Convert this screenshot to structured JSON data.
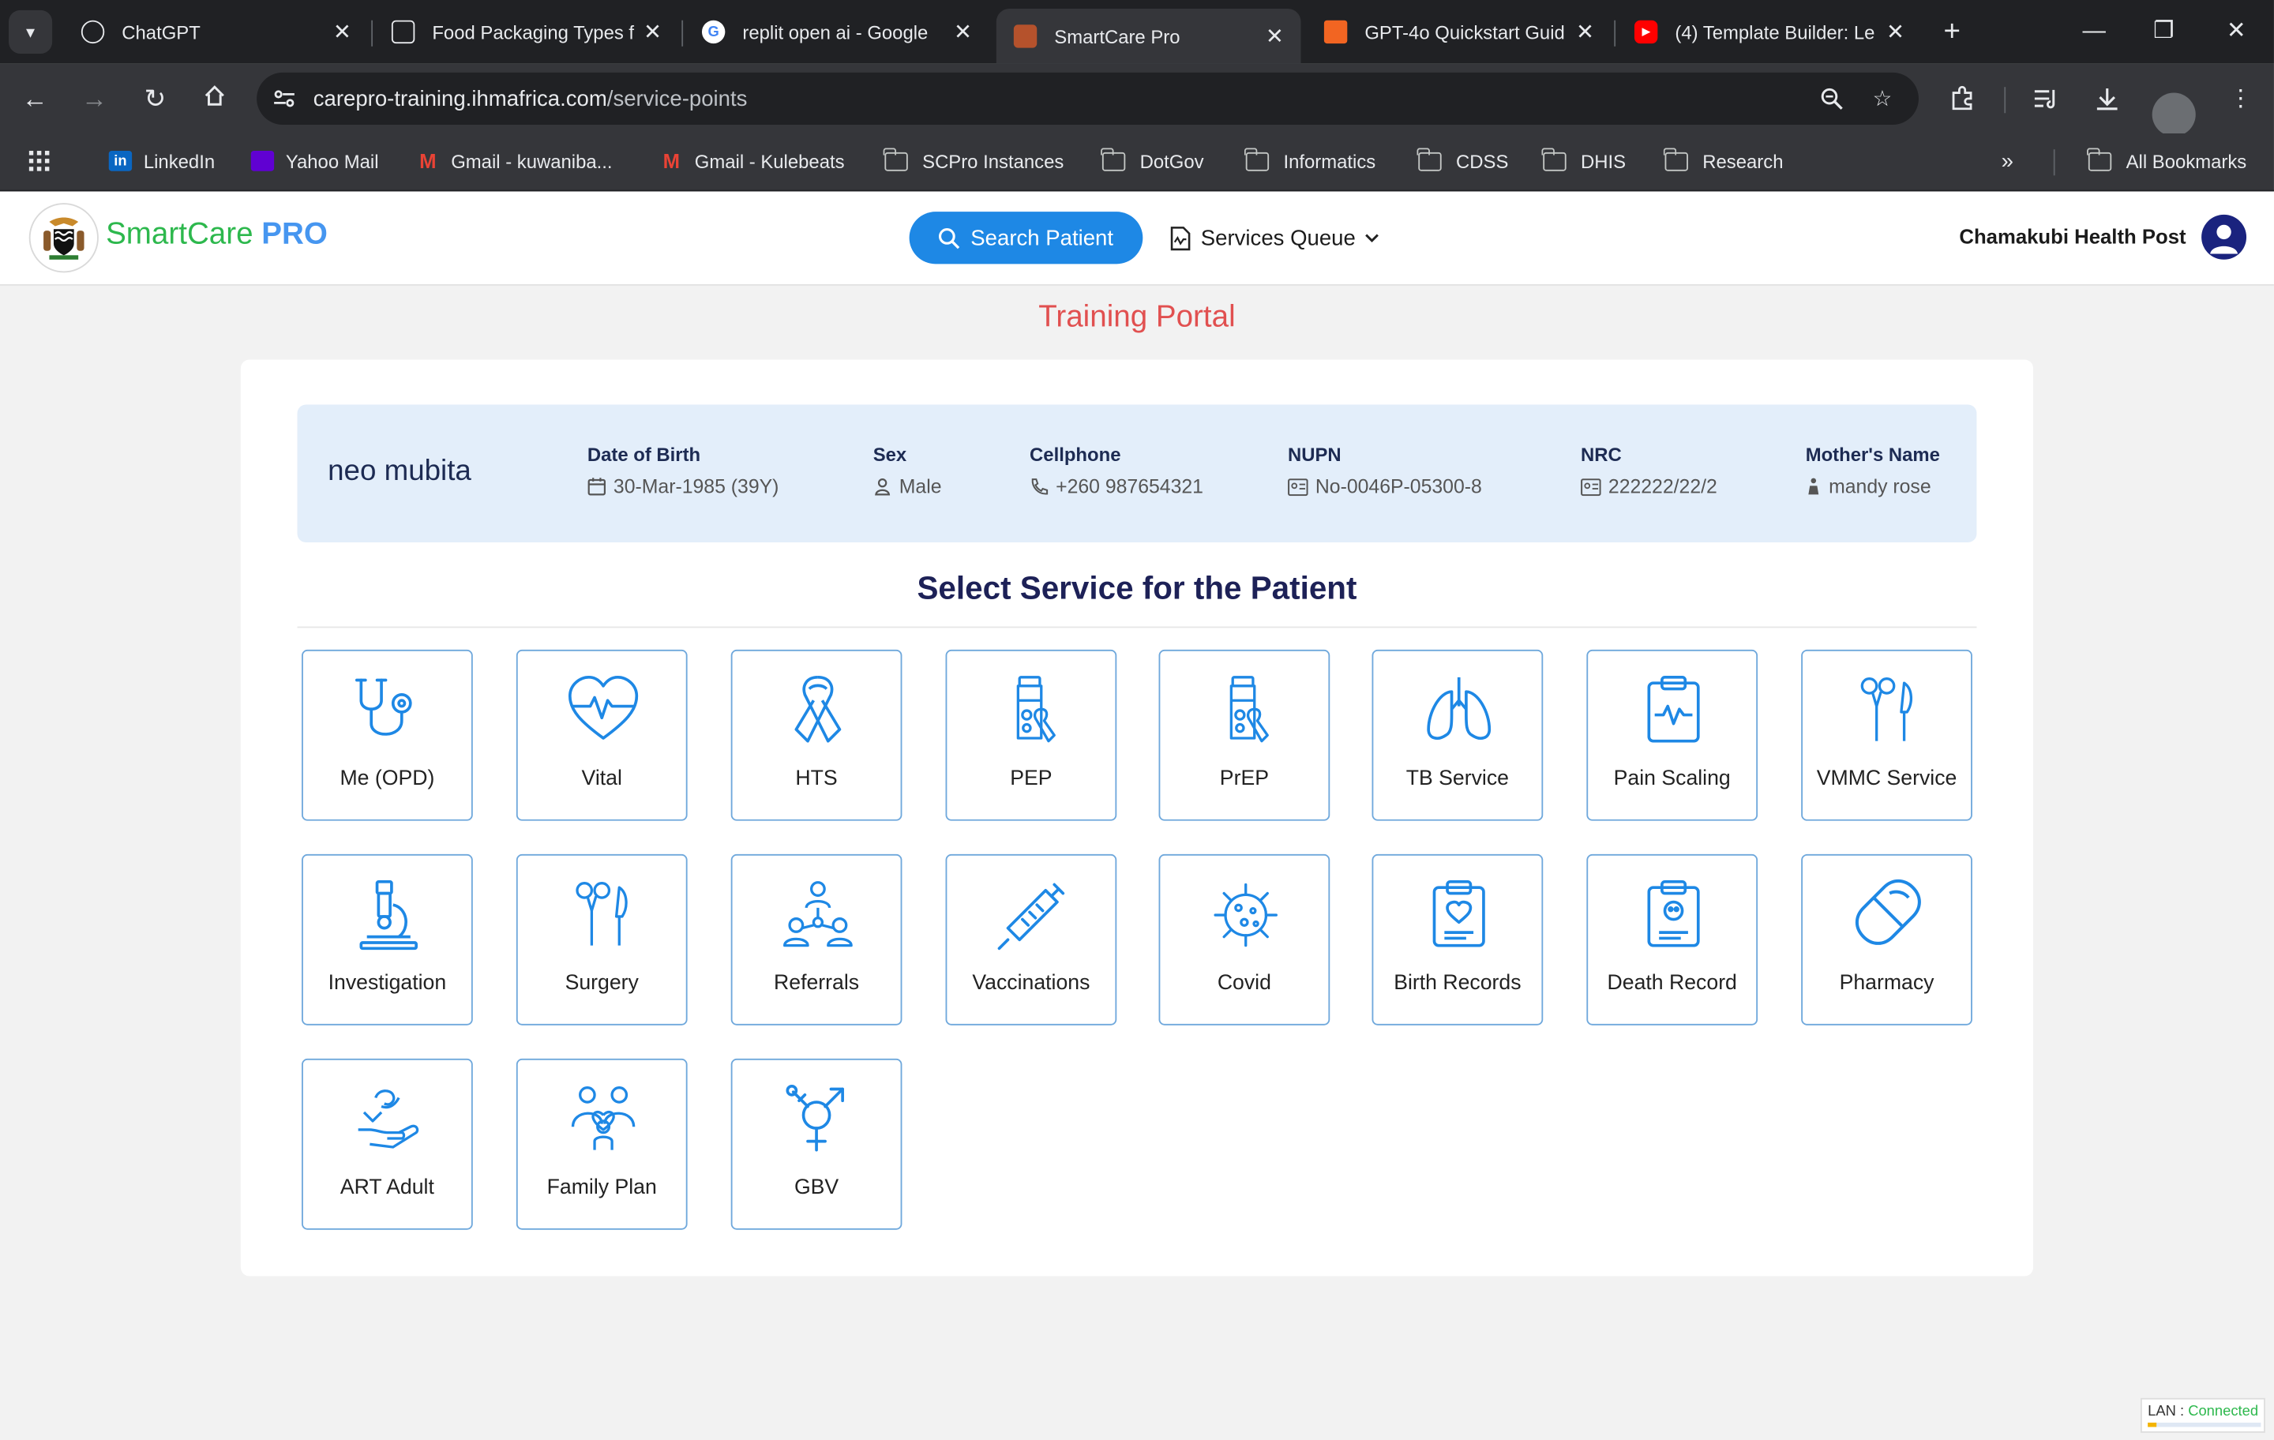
{
  "browser": {
    "tabs": [
      {
        "title": "ChatGPT",
        "favicon": "chatgpt-icon",
        "active": false
      },
      {
        "title": "Food Packaging Types f",
        "favicon": "perplexity-icon",
        "active": false
      },
      {
        "title": "replit open ai - Google",
        "favicon": "google-icon",
        "active": false
      },
      {
        "title": "SmartCare Pro",
        "favicon": "smartcare-icon",
        "active": true
      },
      {
        "title": "GPT-4o Quickstart Guid",
        "favicon": "chunk-icon",
        "active": false
      },
      {
        "title": "(4) Template Builder: Le",
        "favicon": "youtube-icon",
        "active": false
      }
    ],
    "url_host": "carepro-training.ihmafrica.com",
    "url_path": "/service-points",
    "bookmarks": [
      {
        "label": "LinkedIn",
        "icon": "linkedin-icon"
      },
      {
        "label": "Yahoo Mail",
        "icon": "yahoo-icon"
      },
      {
        "label": "Gmail - kuwaniba...",
        "icon": "gmail-icon"
      },
      {
        "label": "Gmail - Kulebeats",
        "icon": "gmail-icon"
      },
      {
        "label": "SCPro Instances",
        "icon": "folder-icon"
      },
      {
        "label": "DotGov",
        "icon": "folder-icon"
      },
      {
        "label": "Informatics",
        "icon": "folder-icon"
      },
      {
        "label": "CDSS",
        "icon": "folder-icon"
      },
      {
        "label": "DHIS",
        "icon": "folder-icon"
      },
      {
        "label": "Research",
        "icon": "folder-icon"
      }
    ],
    "all_bookmarks": "All Bookmarks"
  },
  "app": {
    "brand_part1": "SmartCare ",
    "brand_part2": "PRO",
    "search_button": "Search Patient",
    "queue_button": "Services Queue",
    "facility": "Chamakubi Health Post",
    "portal_title": "Training Portal",
    "section_title": "Select Service for the Patient"
  },
  "patient": {
    "name": "neo mubita",
    "dob_label": "Date of Birth",
    "dob": "30-Mar-1985 (39Y)",
    "sex_label": "Sex",
    "sex": "Male",
    "phone_label": "Cellphone",
    "phone": "+260 987654321",
    "nupn_label": "NUPN",
    "nupn": "No-0046P-05300-8",
    "nrc_label": "NRC",
    "nrc": "222222/22/2",
    "mother_label": "Mother's Name",
    "mother": "mandy rose"
  },
  "services": [
    {
      "label": "Me (OPD)",
      "icon": "stethoscope-icon"
    },
    {
      "label": "Vital",
      "icon": "heart-pulse-icon"
    },
    {
      "label": "HTS",
      "icon": "ribbon-icon"
    },
    {
      "label": "PEP",
      "icon": "medicine-bottle-icon"
    },
    {
      "label": "PrEP",
      "icon": "medicine-bottle-icon"
    },
    {
      "label": "TB Service",
      "icon": "lungs-icon"
    },
    {
      "label": "Pain Scaling",
      "icon": "clipboard-pulse-icon"
    },
    {
      "label": "VMMC Service",
      "icon": "surgical-tools-icon"
    },
    {
      "label": "Investigation",
      "icon": "microscope-icon"
    },
    {
      "label": "Surgery",
      "icon": "surgical-tools-icon"
    },
    {
      "label": "Referrals",
      "icon": "people-network-icon"
    },
    {
      "label": "Vaccinations",
      "icon": "syringe-icon"
    },
    {
      "label": "Covid",
      "icon": "virus-icon"
    },
    {
      "label": "Birth Records",
      "icon": "clipboard-heart-icon"
    },
    {
      "label": "Death Record",
      "icon": "clipboard-skull-icon"
    },
    {
      "label": "Pharmacy",
      "icon": "pill-icon"
    },
    {
      "label": "ART Adult",
      "icon": "hand-pill-icon"
    },
    {
      "label": "Family Plan",
      "icon": "family-icon"
    },
    {
      "label": "GBV",
      "icon": "gender-symbol-icon"
    }
  ],
  "status": {
    "label": "LAN : ",
    "value": "Connected"
  },
  "colors": {
    "accent": "#1e88e5",
    "tile_border": "#6fa8dc",
    "portal_title": "#e15050",
    "brand_green": "#2db84d",
    "brand_blue": "#4696f0"
  }
}
